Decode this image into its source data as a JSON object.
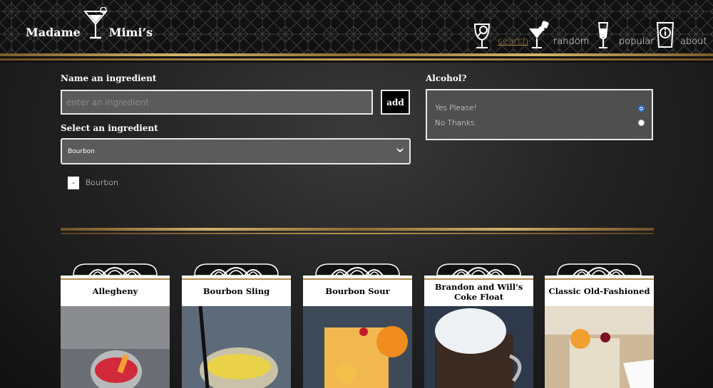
{
  "header": {
    "logo_word1": "Madame",
    "logo_word2": "Mimi’s",
    "nav": [
      {
        "label": "search",
        "icon": "magnifier-glass-icon",
        "active": true
      },
      {
        "label": "random",
        "icon": "martini-dice-icon",
        "active": false
      },
      {
        "label": "popular",
        "icon": "champagne-flute-icon",
        "active": false
      },
      {
        "label": "about",
        "icon": "info-glass-icon",
        "active": false
      }
    ]
  },
  "form": {
    "ingredient_label": "Name an ingredient",
    "ingredient_placeholder": "enter an ingredient",
    "add_label": "add",
    "select_label": "Select an ingredient",
    "select_value": "Bourbon",
    "selected_ingredients": [
      {
        "remove_label": "-",
        "name": "Bourbon"
      }
    ],
    "alcohol_label": "Alcohol?",
    "alcohol_options": [
      {
        "label": "Yes Please!",
        "checked": true
      },
      {
        "label": "No Thanks.",
        "checked": false
      }
    ]
  },
  "cards": [
    {
      "title": "Allegheny"
    },
    {
      "title": "Bourbon Sling"
    },
    {
      "title": "Bourbon Sour"
    },
    {
      "title": "Brandon and Will's Coke Float"
    },
    {
      "title": "Classic Old-Fashioned"
    }
  ],
  "colors": {
    "gold": "#c9a35c",
    "accent_link": "#b08a4c",
    "radio": "#1e6ed8"
  }
}
